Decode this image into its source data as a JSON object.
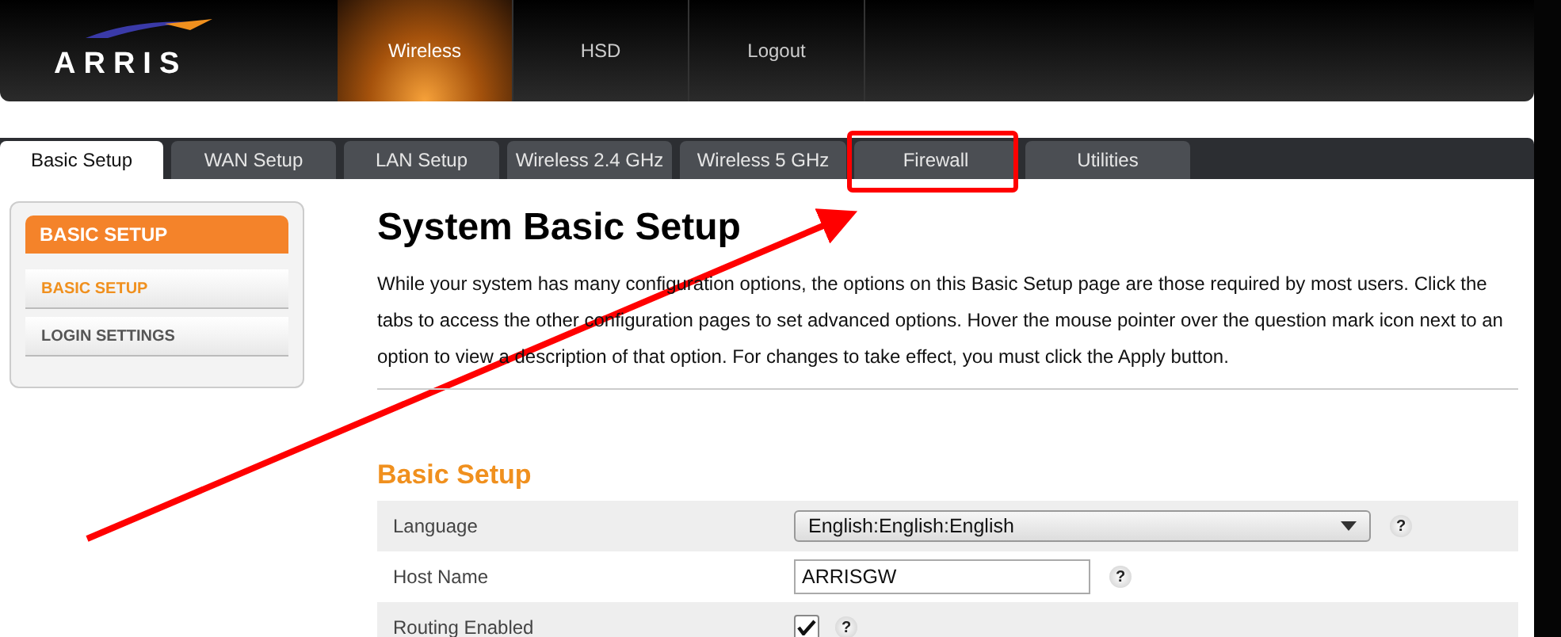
{
  "header": {
    "logo": "ARRIS",
    "nav": [
      {
        "label": "Wireless",
        "selected": true
      },
      {
        "label": "HSD",
        "selected": false
      },
      {
        "label": "Logout",
        "selected": false
      }
    ]
  },
  "tabs": [
    {
      "label": "Basic Setup",
      "selected": true
    },
    {
      "label": "WAN Setup",
      "selected": false
    },
    {
      "label": "LAN Setup",
      "selected": false
    },
    {
      "label": "Wireless 2.4 GHz",
      "selected": false
    },
    {
      "label": "Wireless 5 GHz",
      "selected": false
    },
    {
      "label": "Firewall",
      "selected": false
    },
    {
      "label": "Utilities",
      "selected": false
    }
  ],
  "sidebar": {
    "title": "BASIC SETUP",
    "items": [
      {
        "label": "BASIC SETUP",
        "selected": true
      },
      {
        "label": "LOGIN SETTINGS",
        "selected": false
      }
    ]
  },
  "page": {
    "title": "System Basic Setup",
    "description": "While your system has many configuration options, the options on this Basic Setup page are those required by most users. Click the tabs to access the other configuration pages to set advanced options. Hover the mouse pointer over the question mark icon next to an option to view a description of that option. For changes to take effect, you must click the Apply button."
  },
  "section": {
    "title": "Basic Setup",
    "rows": [
      {
        "kind": "select",
        "label": "Language",
        "value": "English:English:English",
        "help": "?"
      },
      {
        "kind": "text",
        "label": "Host Name",
        "value": "ARRISGW",
        "help": "?"
      },
      {
        "kind": "checkbox",
        "label": "Routing Enabled",
        "checked": true,
        "help": "?"
      }
    ]
  }
}
